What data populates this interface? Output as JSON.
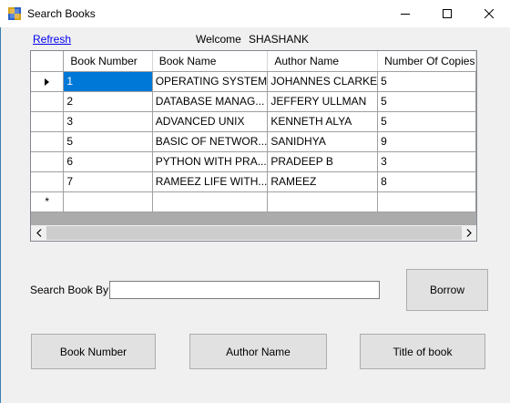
{
  "window": {
    "title": "Search Books",
    "minimize_icon": "minimize-icon",
    "maximize_icon": "maximize-icon",
    "close_icon": "close-icon"
  },
  "header": {
    "refresh_label": "Refresh",
    "welcome_label": "Welcome",
    "username": "SHASHANK"
  },
  "grid": {
    "columns": [
      "Book Number",
      "Book Name",
      "Author Name",
      "Number Of Copies"
    ],
    "rows": [
      [
        "1",
        "OPERATING SYSTEM",
        "JOHANNES CLARKE",
        "5"
      ],
      [
        "2",
        "DATABASE MANAG...",
        "JEFFERY ULLMAN",
        "5"
      ],
      [
        "3",
        "ADVANCED UNIX",
        "KENNETH ALYA",
        "5"
      ],
      [
        "5",
        "BASIC OF NETWOR...",
        "SANIDHYA",
        "9"
      ],
      [
        "6",
        "PYTHON WITH PRA...",
        "PRADEEP B",
        "3"
      ],
      [
        "7",
        "RAMEEZ LIFE WITH...",
        "RAMEEZ",
        "8"
      ]
    ],
    "new_row_marker": "*",
    "selected_row_indicator": "row-pointer-icon"
  },
  "search": {
    "label": "Search Book By",
    "value": "",
    "placeholder": ""
  },
  "buttons": {
    "borrow": "Borrow",
    "book_number": "Book Number",
    "author_name": "Author Name",
    "title_of_book": "Title of book"
  },
  "colors": {
    "selection": "#0078d7",
    "link": "#0000ee",
    "button_bg": "#e1e1e1",
    "grid_background": "#ababab"
  }
}
